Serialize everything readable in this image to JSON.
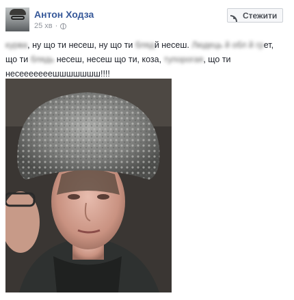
{
  "post": {
    "author": "Антон Ходза",
    "time": "25 хв",
    "follow_label": "Стежити",
    "text": {
      "blur1": "курва",
      "seg1": ", ну що ти несеш, ну що ти ",
      "blur2": "бляд",
      "seg2": "й несеш. ",
      "blur3": "Людець й обл й гр",
      "seg3": "ет, що ти ",
      "blur4": "блядь",
      "seg4": " несеш, несеш що ти, коза, ",
      "blur5": "тупорогая",
      "seg5": ", що ти несееееееешшшшшшш!!!!"
    }
  },
  "icons": {
    "privacy": "globe-icon",
    "follow": "rss-icon"
  },
  "colors": {
    "author": "#365899",
    "meta": "#90949c",
    "text": "#1d2129"
  }
}
